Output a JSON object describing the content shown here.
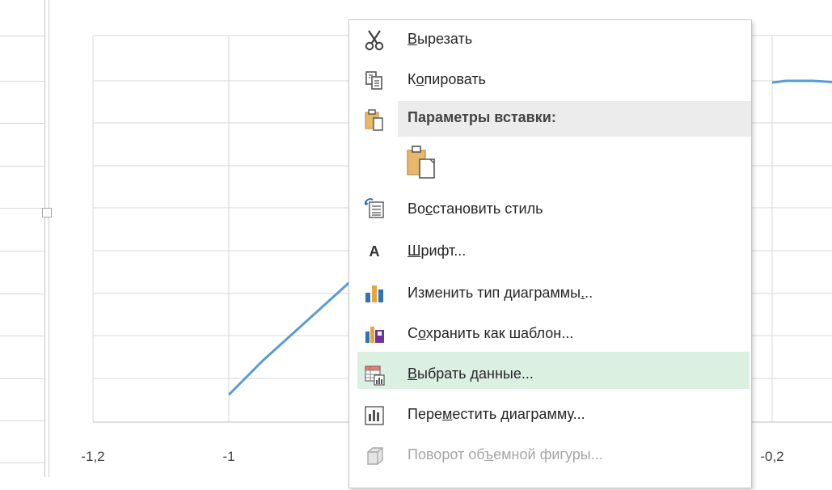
{
  "chart_data": {
    "type": "line",
    "x_ticks": [
      "-1,2",
      "-1",
      "-0,2"
    ],
    "series": [
      {
        "color": "#5b9bd5",
        "points": [
          [
            -1.0,
            0.08
          ],
          [
            -0.95,
            0.18
          ],
          [
            -0.9,
            0.27
          ],
          [
            -0.85,
            0.36
          ],
          [
            -0.8,
            0.45
          ],
          [
            -0.76,
            0.52
          ],
          [
            -0.2,
            0.995
          ],
          [
            -0.18,
            1.0
          ],
          [
            -0.14,
            1.0
          ],
          [
            -0.1,
            0.995
          ]
        ]
      }
    ]
  },
  "context_menu": {
    "items": [
      {
        "id": "cut",
        "pre": "",
        "ul": "В",
        "post": "ырезать",
        "icon": "scissors-icon",
        "disabled": false
      },
      {
        "id": "copy",
        "pre": "К",
        "ul": "о",
        "post": "пировать",
        "icon": "copy-icon",
        "disabled": false
      },
      {
        "id": "reset-style",
        "pre": "Во",
        "ul": "с",
        "post": "становить стиль",
        "icon": "reset-style-icon",
        "disabled": false
      },
      {
        "id": "font",
        "pre": "",
        "ul": "Ш",
        "post": "рифт...",
        "icon": "font-icon",
        "disabled": false
      },
      {
        "id": "change-chart-type",
        "pre": "Изменить тип диаграммы",
        "ul": ".",
        "post": "..",
        "icon": "chart-type-icon",
        "disabled": false
      },
      {
        "id": "save-template",
        "pre": "С",
        "ul": "о",
        "post": "хранить как шаблон...",
        "icon": "save-template-icon",
        "disabled": false
      },
      {
        "id": "select-data",
        "pre": "",
        "ul": "В",
        "post": "ыбрать данные...",
        "icon": "select-data-icon",
        "disabled": false
      },
      {
        "id": "move-chart",
        "pre": "Пере",
        "ul": "м",
        "post": "естить диаграмму...",
        "icon": "move-chart-icon",
        "disabled": false
      },
      {
        "id": "3d-rotation",
        "pre": "Поворот об",
        "ul": "ъ",
        "post": "емной фигуры...",
        "icon": "3d-rotation-icon",
        "disabled": true
      }
    ],
    "paste_header": "Параметры вставки:",
    "paste_option_icon": "paste-icon",
    "highlighted": "select-data",
    "highlight_color": "#dcf0e2"
  }
}
